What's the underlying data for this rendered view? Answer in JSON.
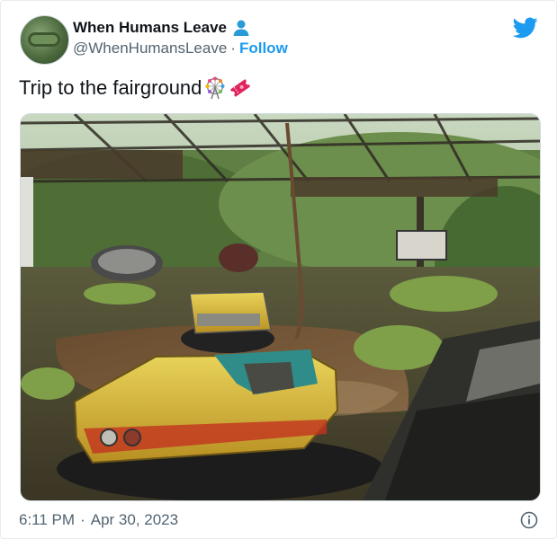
{
  "tweet": {
    "display_name": "When Humans Leave",
    "handle": "@WhenHumansLeave",
    "separator": "·",
    "follow_label": "Follow",
    "text": "Trip to the fairground",
    "emojis": [
      "ferris-wheel-emoji",
      "ticket-emoji"
    ],
    "time": "6:11 PM",
    "date": "Apr 30, 2023",
    "date_separator": "·",
    "photo_description_icon": "abandoned-bumper-cars-photo"
  },
  "icons": {
    "brand": "twitter-bird-icon",
    "verified_person": "person-icon",
    "info": "info-icon"
  },
  "colors": {
    "accent": "#1d9bf0",
    "text": "#0f1419",
    "muted": "#536471",
    "emoji_red": "#e0245e"
  }
}
